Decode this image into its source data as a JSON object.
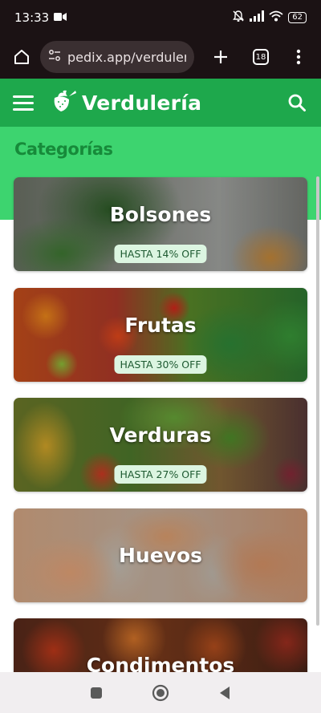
{
  "status_bar": {
    "time": "13:33",
    "battery": "62",
    "icons": [
      "video-camera-icon",
      "bell-off-icon",
      "signal-icon",
      "wifi-icon",
      "battery-icon"
    ]
  },
  "browser": {
    "url": "pedix.app/verduleria",
    "tab_count": "18",
    "icons": [
      "home-icon",
      "site-settings-icon",
      "new-tab-plus-icon",
      "tabs-icon",
      "more-vert-icon"
    ]
  },
  "app": {
    "brand": "Verdulería",
    "icons": [
      "hamburger-menu-icon",
      "strawberry-logo-icon",
      "search-icon"
    ]
  },
  "section": {
    "title": "Categorías"
  },
  "categories": [
    {
      "name": "Bolsones",
      "badge": "HASTA 14% OFF"
    },
    {
      "name": "Frutas",
      "badge": "HASTA 30% OFF"
    },
    {
      "name": "Verduras",
      "badge": "HASTA 27% OFF"
    },
    {
      "name": "Huevos",
      "badge": ""
    },
    {
      "name": "Condimentos",
      "badge": ""
    }
  ],
  "colors": {
    "status_bg": "#1b1214",
    "header_green": "#1ea84c",
    "band_green": "#3dd46f",
    "title_green": "#178a3a",
    "badge_bg": "#dcf5e1"
  },
  "nav": {
    "icons": [
      "recents-square-icon",
      "home-circle-icon",
      "back-triangle-icon"
    ]
  }
}
